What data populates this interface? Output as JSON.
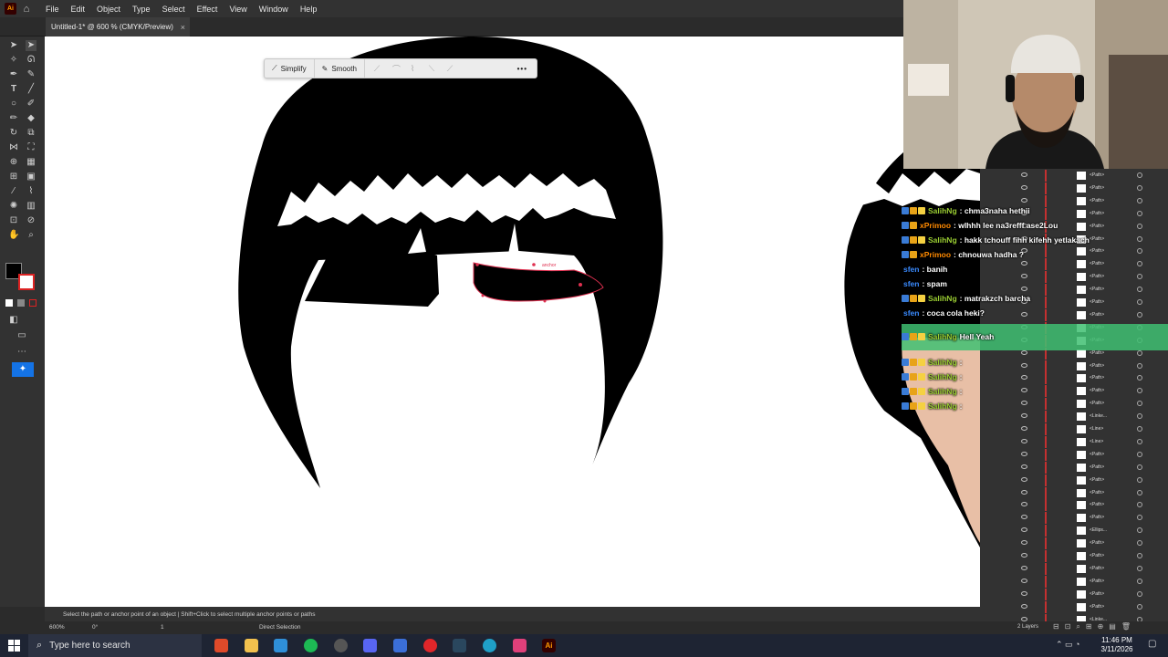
{
  "app": {
    "logo": "Ai",
    "home_icon": "home-icon"
  },
  "menu": [
    "File",
    "Edit",
    "Object",
    "Type",
    "Select",
    "Effect",
    "View",
    "Window",
    "Help"
  ],
  "document_tab": {
    "title": "Untitled-1* @ 600 % (CMYK/Preview)",
    "close": "×"
  },
  "context_toolbar": {
    "simplify": "Simplify",
    "smooth": "Smooth",
    "more": "•••"
  },
  "canvas": {
    "hover_label": "anchor"
  },
  "status": {
    "hint": "Select the path or anchor point of an object  |  Shift+Click to select multiple anchor points or paths",
    "zoom": "600%",
    "rotation": "0°",
    "artboard": "1",
    "tool": "Direct Selection"
  },
  "layers": {
    "count_label": "2 Layers",
    "rows": [
      "<Path>",
      "<Path>",
      "<Path>",
      "<Path>",
      "<Path>",
      "<Path>",
      "<Path>",
      "<Path>",
      "<Path>",
      "<Path>",
      "<Path>",
      "<Path>",
      "<Path>",
      "<Path>",
      "<Path>",
      "<Path>",
      "<Path>",
      "<Path>",
      "<Path>",
      "<Linke...",
      "<Line>",
      "<Line>",
      "<Path>",
      "<Path>",
      "<Path>",
      "<Path>",
      "<Path>",
      "<Path>",
      "<Ellips...",
      "<Path>",
      "<Path>",
      "<Path>",
      "<Path>",
      "<Path>",
      "<Path>",
      "<Linke..."
    ]
  },
  "chat": [
    {
      "user": "SalihNg",
      "msg": ": chma3naha hethii",
      "color": "#9acd32"
    },
    {
      "user": "xPrimoo",
      "msg": ": wlhhh lee na3refff ase2Lou",
      "color": "#ff8a00"
    },
    {
      "user": "SalihNg",
      "msg": ": hakk tchouff fihh kifehh yetlakach",
      "color": "#9acd32"
    },
    {
      "user": "xPrimoo",
      "msg": ": chnouwa hadha ?",
      "color": "#ff8a00"
    },
    {
      "user": "sfen",
      "msg": ": banih",
      "color": "#3a8bff"
    },
    {
      "user": "sfen",
      "msg": ": spam",
      "color": "#3a8bff"
    },
    {
      "user": "SalihNg",
      "msg": ": matrakzch barcha",
      "color": "#9acd32"
    },
    {
      "user": "sfen",
      "msg": ": coca cola heki?",
      "color": "#3a8bff"
    },
    {
      "user": "SalihNg",
      "msg": "Hell Yeah",
      "color": "#9acd32"
    },
    {
      "user": "SalihNg",
      "msg": ":",
      "color": "#9acd32"
    },
    {
      "user": "SalihNg",
      "msg": ":",
      "color": "#9acd32"
    },
    {
      "user": "SalihNg",
      "msg": ":",
      "color": "#9acd32"
    },
    {
      "user": "SalihNg",
      "msg": ":",
      "color": "#9acd32"
    }
  ],
  "taskbar": {
    "search_placeholder": "Type here to search",
    "time": "11:46 PM",
    "date": "3/11/2026"
  }
}
